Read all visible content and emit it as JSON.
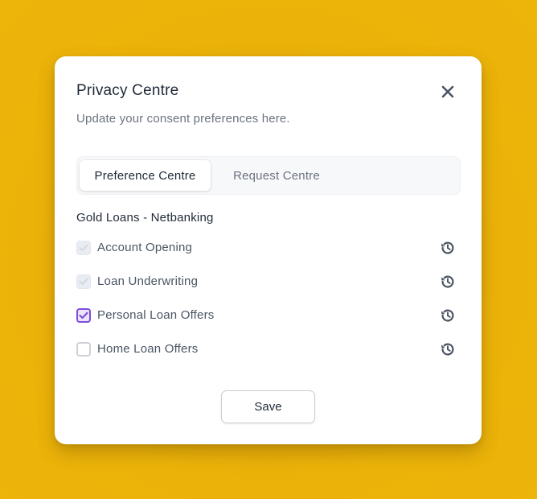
{
  "modal": {
    "title": "Privacy Centre",
    "subtitle": "Update your consent preferences here.",
    "close_icon": "close-icon"
  },
  "tabs": [
    {
      "label": "Preference Centre",
      "active": true
    },
    {
      "label": "Request Centre",
      "active": false
    }
  ],
  "section": {
    "title": "Gold Loans - Netbanking",
    "items": [
      {
        "label": "Account Opening",
        "state": "checked-disabled",
        "icon": "history-icon"
      },
      {
        "label": "Loan Underwriting",
        "state": "checked-disabled",
        "icon": "history-icon"
      },
      {
        "label": "Personal Loan Offers",
        "state": "checked",
        "icon": "history-icon"
      },
      {
        "label": "Home Loan Offers",
        "state": "unchecked",
        "icon": "history-icon"
      }
    ]
  },
  "actions": {
    "save_label": "Save"
  },
  "colors": {
    "background": "#E9AF08",
    "accent": "#7C4DDB",
    "text_primary": "#1F2937",
    "text_secondary": "#6B7280"
  }
}
